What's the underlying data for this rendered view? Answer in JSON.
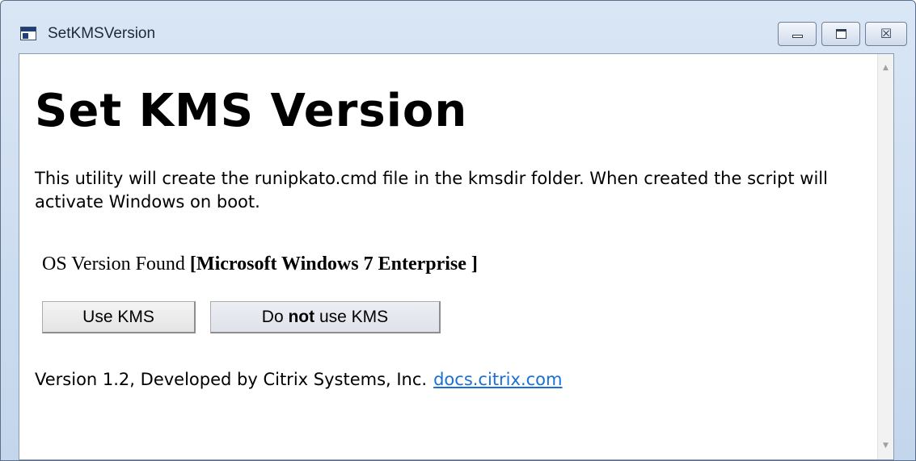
{
  "window": {
    "title": "SetKMSVersion",
    "icon": "app-window-icon",
    "controls": {
      "minimize_icon": "minimize-icon",
      "maximize_icon": "maximize-icon",
      "close_symbol": "☒"
    }
  },
  "main": {
    "heading": "Set KMS Version",
    "description": "This utility will create the runipkato.cmd file in the kmsdir folder. When created the script will activate Windows on boot.",
    "os_label": "OS Version Found",
    "os_value": "[Microsoft Windows 7 Enterprise ]",
    "buttons": {
      "use_kms": "Use KMS",
      "not_use_prefix": "Do ",
      "not_use_emphasis": "not",
      "not_use_suffix": " use KMS"
    },
    "footer": {
      "text": "Version 1.2, Developed by Citrix Systems, Inc.",
      "link": "docs.citrix.com"
    }
  },
  "scrollbar": {
    "up_arrow": "▲",
    "down_arrow": "▼"
  },
  "colors": {
    "link": "#1a6fd4",
    "titlebar": "#c4d6ec"
  }
}
